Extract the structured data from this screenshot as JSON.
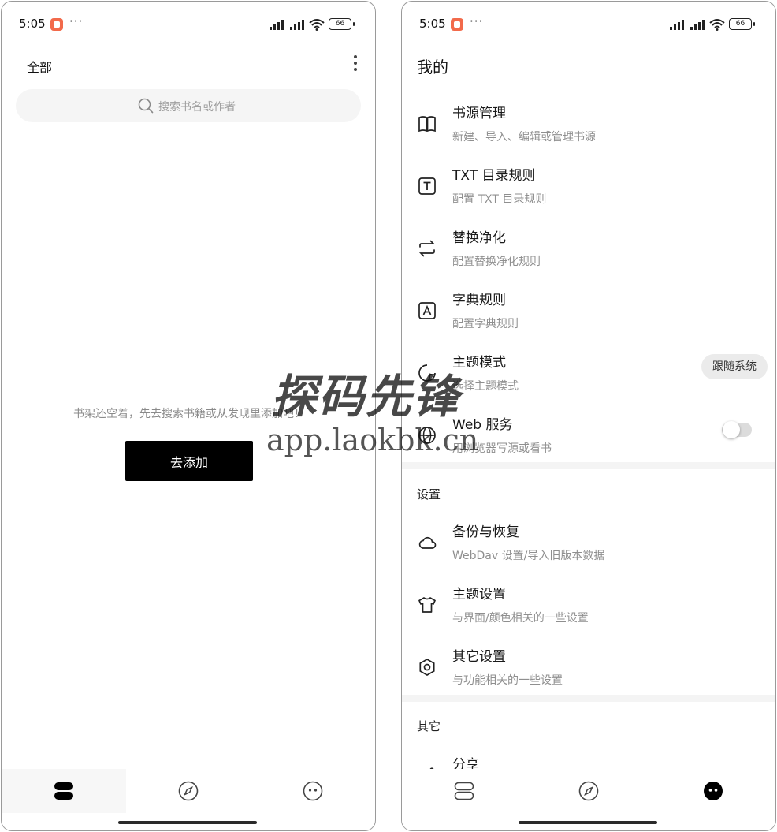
{
  "left_screen": {
    "status": {
      "time": "5:05",
      "battery": "66"
    },
    "header": {
      "title": "全部"
    },
    "search": {
      "placeholder": "搜索书名或作者"
    },
    "empty": {
      "message": "书架还空着，先去搜索书籍或从发现里添加吧！",
      "button": "去添加"
    },
    "nav": [
      "bookshelf-icon",
      "compass-icon",
      "face-icon"
    ]
  },
  "right_screen": {
    "status": {
      "time": "5:05",
      "battery": "66"
    },
    "title": "我的",
    "items": [
      {
        "icon": "book-open-icon",
        "title": "书源管理",
        "desc": "新建、导入、编辑或管理书源"
      },
      {
        "icon": "text-box-icon",
        "title": "TXT 目录规则",
        "desc": "配置 TXT 目录规则"
      },
      {
        "icon": "swap-icon",
        "title": "替换净化",
        "desc": "配置替换净化规则"
      },
      {
        "icon": "dictionary-icon",
        "title": "字典规则",
        "desc": "配置字典规则"
      },
      {
        "icon": "theme-icon",
        "title": "主题模式",
        "desc": "选择主题模式",
        "chip": "跟随系统"
      },
      {
        "icon": "globe-icon",
        "title": "Web 服务",
        "desc": "用浏览器写源或看书",
        "toggle": false
      }
    ],
    "settings_section": {
      "title": "设置",
      "items": [
        {
          "icon": "cloud-icon",
          "title": "备份与恢复",
          "desc": "WebDav 设置/导入旧版本数据"
        },
        {
          "icon": "tshirt-icon",
          "title": "主题设置",
          "desc": "与界面/颜色相关的一些设置"
        },
        {
          "icon": "hexagon-icon",
          "title": "其它设置",
          "desc": "与功能相关的一些设置"
        }
      ]
    },
    "other_section": {
      "title": "其它",
      "items": [
        {
          "icon": "share-icon",
          "title": "分享"
        }
      ]
    }
  },
  "watermark": {
    "logo": "探码先锋",
    "url": "app.laokbk.cn"
  },
  "colors": {
    "accent": "#000000",
    "notification": "#f26a4b",
    "muted_text": "#8f8f8f"
  }
}
